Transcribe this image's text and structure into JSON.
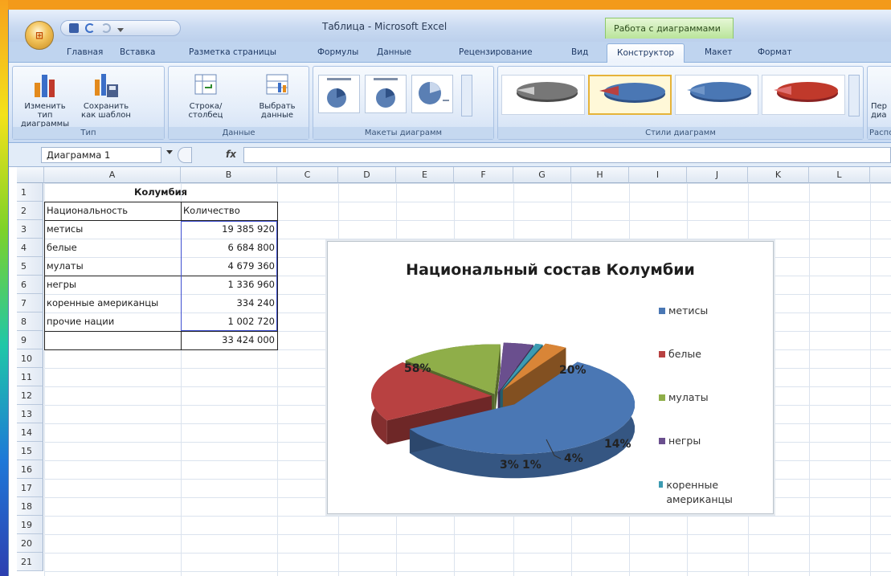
{
  "window": {
    "title": "Таблица - Microsoft Excel",
    "context_tab_header": "Работа с диаграммами"
  },
  "tabs": [
    "Главная",
    "Вставка",
    "Разметка страницы",
    "Формулы",
    "Данные",
    "Рецензирование",
    "Вид",
    "Конструктор",
    "Макет",
    "Формат"
  ],
  "active_tab": "Конструктор",
  "ribbon": {
    "groups": {
      "type": "Тип",
      "data": "Данные",
      "layouts": "Макеты диаграмм",
      "styles": "Стили диаграмм",
      "location": "Распол"
    },
    "buttons": {
      "change_type": "Изменить тип диаграммы",
      "save_template": "Сохранить как шаблон",
      "row_col": "Строка/столбец",
      "select_data": "Выбрать данные",
      "move": "Пер диа"
    }
  },
  "formula_bar": {
    "name_box": "Диаграмма 1",
    "fx": "fx",
    "value": ""
  },
  "columns": [
    "A",
    "B",
    "C",
    "D",
    "E",
    "F",
    "G",
    "H",
    "I",
    "J",
    "K",
    "L"
  ],
  "rows": [
    "1",
    "2",
    "3",
    "4",
    "5",
    "6",
    "7",
    "8",
    "9",
    "10",
    "11",
    "12",
    "13",
    "14",
    "15",
    "16",
    "17",
    "18",
    "19",
    "20",
    "21"
  ],
  "sheet": {
    "title": "Колумбия",
    "header": {
      "nat": "Национальность",
      "qty": "Количество"
    },
    "data": [
      {
        "nat": "метисы",
        "qty": "19 385 920"
      },
      {
        "nat": "белые",
        "qty": "6 684 800"
      },
      {
        "nat": "мулаты",
        "qty": "4 679 360"
      },
      {
        "nat": "негры",
        "qty": "1 336 960"
      },
      {
        "nat": "коренные американцы",
        "qty": "334 240"
      },
      {
        "nat": "прочие нации",
        "qty": "1 002 720"
      }
    ],
    "total": "33 424 000"
  },
  "chart_data": {
    "type": "pie",
    "title": "Национальный состав Колумбии",
    "categories": [
      "метисы",
      "белые",
      "мулаты",
      "негры",
      "коренные американцы",
      "прочие нации"
    ],
    "values": [
      19385920,
      6684800,
      4679360,
      1336960,
      334240,
      1002720
    ],
    "labels": [
      "58%",
      "20%",
      "14%",
      "4%",
      "1%",
      "3%"
    ],
    "colors": [
      "#4a77b4",
      "#b84141",
      "#8fae49",
      "#6a4f8e",
      "#3c9bb2",
      "#d98537"
    ],
    "legend": {
      "placement": "right",
      "entries": [
        "метисы",
        "белые",
        "мулаты",
        "негры",
        "коренные американцы"
      ]
    }
  }
}
